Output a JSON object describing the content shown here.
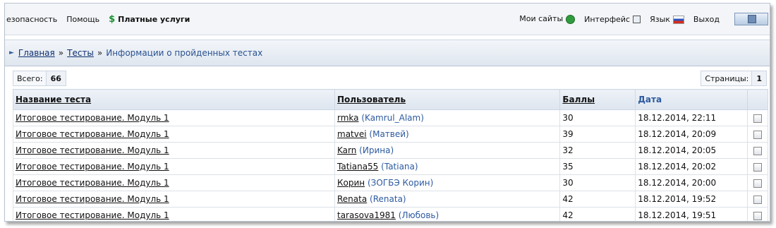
{
  "topbar": {
    "left": [
      "езопасность",
      "Помощь"
    ],
    "paid": "Платные услуги",
    "right": [
      "Мои сайты",
      "Интерфейс",
      "Язык",
      "Выход"
    ]
  },
  "breadcrumb": {
    "home": "Главная",
    "tests": "Тесты",
    "current": "Информации о пройденных тестах",
    "separator": "»"
  },
  "summary": {
    "total_label": "Всего:",
    "total_value": "66",
    "pages_label": "Страницы:",
    "pages_value": "1"
  },
  "table": {
    "headers": {
      "test": "Название теста",
      "user": "Пользователь",
      "score": "Баллы",
      "date": "Дата"
    },
    "rows": [
      {
        "test": "Итоговое тестирование. Модуль 1",
        "login": "rmka",
        "name": "Kamrul_Alam",
        "score": "30",
        "date": "18.12.2014, 22:11"
      },
      {
        "test": "Итоговое тестирование. Модуль 1",
        "login": "matvei",
        "name": "Матвей",
        "score": "39",
        "date": "18.12.2014, 20:09"
      },
      {
        "test": "Итоговое тестирование. Модуль 1",
        "login": "Karn",
        "name": "Ирина",
        "score": "32",
        "date": "18.12.2014, 20:05"
      },
      {
        "test": "Итоговое тестирование. Модуль 1",
        "login": "Tatiana55",
        "name": "Tatiana",
        "score": "35",
        "date": "18.12.2014, 20:02"
      },
      {
        "test": "Итоговое тестирование. Модуль 1",
        "login": "Корин",
        "name": "ЗОГБЭ Корин",
        "score": "30",
        "date": "18.12.2014, 20:00"
      },
      {
        "test": "Итоговое тестирование. Модуль 1",
        "login": "Renata",
        "name": "Renata",
        "score": "42",
        "date": "18.12.2014, 19:52"
      },
      {
        "test": "Итоговое тестирование. Модуль 1",
        "login": "tarasova1981",
        "name": "Любовь",
        "score": "42",
        "date": "18.12.2014, 19:51"
      }
    ]
  },
  "icons": {
    "paid": "dollar-icon",
    "sites": "globe-icon",
    "interface": "checkbox-icon",
    "language": "russian-flag-icon"
  }
}
